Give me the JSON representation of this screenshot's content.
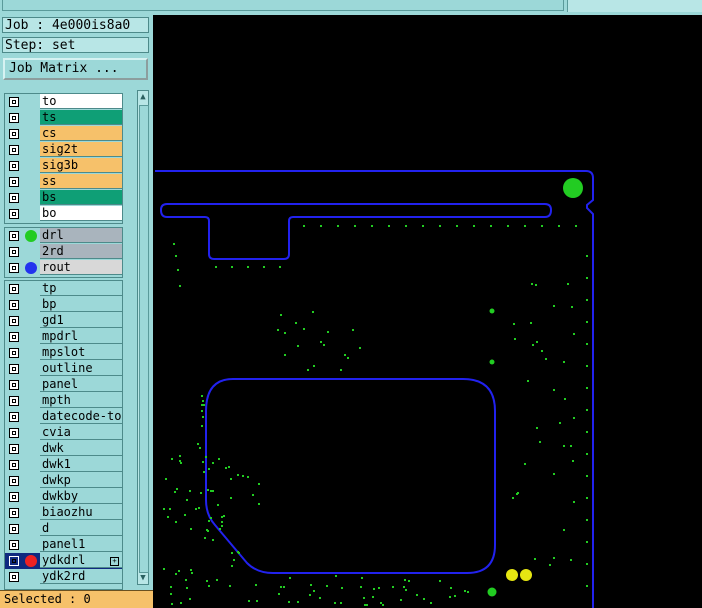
{
  "header": {
    "job_label": "Job : 4e000is8a0",
    "step_label": "Step: set",
    "job_matrix_button": "Job Matrix ..."
  },
  "board_layers": [
    {
      "name": "to",
      "color": "#ffffff"
    },
    {
      "name": "ts",
      "color": "#0f9f76"
    },
    {
      "name": "cs",
      "color": "#f6c16a"
    },
    {
      "name": "sig2t",
      "color": "#f6c16a"
    },
    {
      "name": "sig3b",
      "color": "#f6c16a"
    },
    {
      "name": "ss",
      "color": "#f6c16a"
    },
    {
      "name": "bs",
      "color": "#0f9f76"
    },
    {
      "name": "bo",
      "color": "#ffffff"
    }
  ],
  "drill_layers": [
    {
      "name": "drl",
      "color": "#a9b4bd",
      "dot": "#22cc22"
    },
    {
      "name": "2rd",
      "color": "#a9b4bd",
      "dot": ""
    },
    {
      "name": "rout",
      "color": "#d8d8d8",
      "dot": "#2233ee"
    }
  ],
  "misc_layers": [
    {
      "name": "tp"
    },
    {
      "name": "bp"
    },
    {
      "name": "gd1"
    },
    {
      "name": "mpdrl"
    },
    {
      "name": "mpslot"
    },
    {
      "name": "outline"
    },
    {
      "name": "panel"
    },
    {
      "name": "mpth"
    },
    {
      "name": "datecode-to"
    },
    {
      "name": "cvia"
    },
    {
      "name": "dwk"
    },
    {
      "name": "dwk1"
    },
    {
      "name": "dwkp"
    },
    {
      "name": "dwkby"
    },
    {
      "name": "biaozhu"
    },
    {
      "name": "d"
    },
    {
      "name": "panel1"
    },
    {
      "name": "ydkdrl",
      "selected": true,
      "dot": "#ee2222",
      "expand": "+"
    },
    {
      "name": "ydk2rd"
    }
  ],
  "status": {
    "selected_text": "Selected : 0"
  },
  "colors": {
    "panel_bg": "#9cd8d8",
    "canvas_bg": "#000000",
    "outline": "#2222ee",
    "pad": "#22cc22",
    "pad_yellow": "#e6e612"
  },
  "icons": {
    "scroll_up": "▲",
    "scroll_down": "▼"
  }
}
